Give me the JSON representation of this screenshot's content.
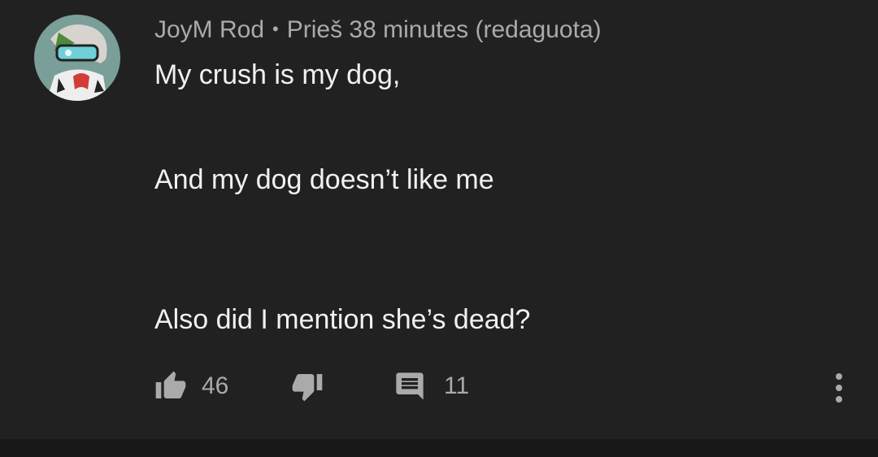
{
  "comment": {
    "author": "JoyM Rod",
    "separator": "•",
    "timestamp": "Prieš 38 minutes (redaguota)",
    "lines": [
      "My crush is my dog,",
      "And my dog doesn’t like me",
      "Also did I mention she’s dead?"
    ],
    "like_count": "46",
    "reply_count": "11"
  },
  "icons": {
    "like": "thumbs-up-icon",
    "dislike": "thumbs-down-icon",
    "replies": "comment-icon",
    "menu": "more-vertical-icon"
  },
  "colors": {
    "background": "#212121",
    "primary_text": "#f1f1f1",
    "secondary_text": "#aaaaaa",
    "avatar_background": "#7a9e98"
  }
}
